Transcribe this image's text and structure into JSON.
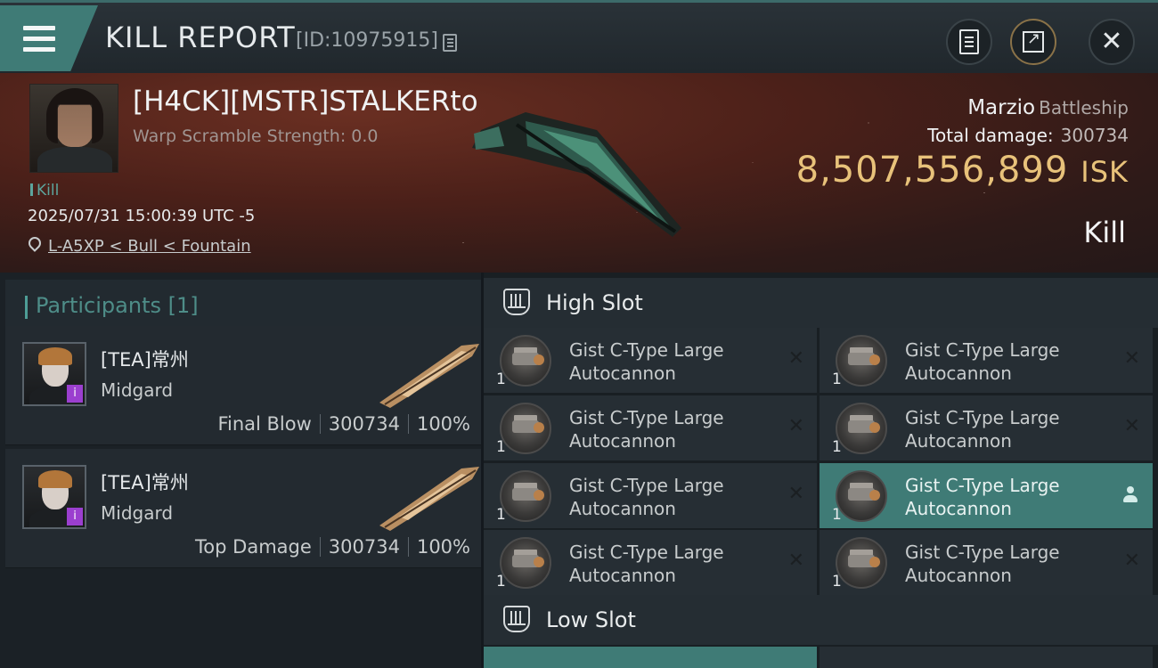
{
  "header": {
    "title": "KILL REPORT",
    "id_text": "[ID:10975915]"
  },
  "victim": {
    "name": "[H4CK][MSTR]STALKERto",
    "scramble": "Warp Scramble Strength: 0.0",
    "kill_tag": "Kill",
    "datetime": "2025/07/31 15:00:39 UTC -5",
    "location": "L-A5XP < Bull < Fountain",
    "ship_name": "Marzio",
    "ship_class": "Battleship",
    "total_damage_label": "Total damage:",
    "total_damage_value": "300734",
    "isk_value": "8,507,556,899",
    "isk_unit": "ISK",
    "result": "Kill"
  },
  "participants": {
    "header": "Participants [1]",
    "items": [
      {
        "name": "[TEA]常州",
        "ship": "Midgard",
        "label": "Final Blow",
        "damage": "300734",
        "percent": "100%"
      },
      {
        "name": "[TEA]常州",
        "ship": "Midgard",
        "label": "Top Damage",
        "damage": "300734",
        "percent": "100%"
      }
    ]
  },
  "slots": {
    "high_title": "High Slot",
    "low_title": "Low Slot",
    "high_modules": [
      {
        "name": "Gist C-Type Large Autocannon",
        "qty": "1"
      },
      {
        "name": "Gist C-Type Large Autocannon",
        "qty": "1"
      },
      {
        "name": "Gist C-Type Large Autocannon",
        "qty": "1"
      },
      {
        "name": "Gist C-Type Large Autocannon",
        "qty": "1"
      },
      {
        "name": "Gist C-Type Large Autocannon",
        "qty": "1"
      },
      {
        "name": "Gist C-Type Large Autocannon",
        "qty": "1"
      },
      {
        "name": "Gist C-Type Large Autocannon",
        "qty": "1"
      },
      {
        "name": "Gist C-Type Large Autocannon",
        "qty": "1"
      }
    ]
  },
  "colors": {
    "accent": "#3f7b76",
    "isk": "#e8c27a",
    "participants_header": "#4e8d88"
  }
}
